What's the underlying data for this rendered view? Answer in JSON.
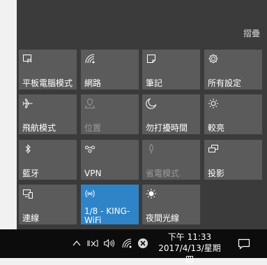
{
  "header": {
    "collapse_label": "摺疊"
  },
  "tiles": [
    {
      "label": "平板電腦模式",
      "icon": "tablet-mode-icon",
      "state": "normal"
    },
    {
      "label": "網路",
      "icon": "network-icon",
      "state": "normal"
    },
    {
      "label": "筆記",
      "icon": "note-icon",
      "state": "normal"
    },
    {
      "label": "所有設定",
      "icon": "gear-icon",
      "state": "normal"
    },
    {
      "label": "飛航模式",
      "icon": "airplane-icon",
      "state": "normal"
    },
    {
      "label": "位置",
      "icon": "location-icon",
      "state": "disabled"
    },
    {
      "label": "勿打擾時間",
      "icon": "moon-icon",
      "state": "normal"
    },
    {
      "label": "較亮",
      "icon": "brightness-icon",
      "state": "normal"
    },
    {
      "label": "藍牙",
      "icon": "bluetooth-icon",
      "state": "normal"
    },
    {
      "label": "VPN",
      "icon": "vpn-icon",
      "state": "normal"
    },
    {
      "label": "省電模式",
      "icon": "battery-saver-icon",
      "state": "disabled"
    },
    {
      "label": "投影",
      "icon": "project-icon",
      "state": "normal"
    },
    {
      "label": "連線",
      "icon": "connect-icon",
      "state": "normal"
    },
    {
      "label": "1/8 - KING-\nWiFi",
      "icon": "wifi-hotspot-icon",
      "state": "active"
    },
    {
      "label": "夜間光線",
      "icon": "night-light-icon",
      "state": "normal"
    }
  ],
  "taskbar": {
    "time": "下午 11:33",
    "date": "2017/4/13/星期四",
    "tray_icons": [
      "chevron-up-icon",
      "input-method-icon",
      "volume-icon",
      "wifi-icon",
      "close-circle-icon"
    ]
  },
  "colors": {
    "panel_bg": "#3b3b3b",
    "tile_bg": "#5b5b5b",
    "tile_active": "#2e84c9",
    "taskbar_bg": "#0c0c0c"
  }
}
